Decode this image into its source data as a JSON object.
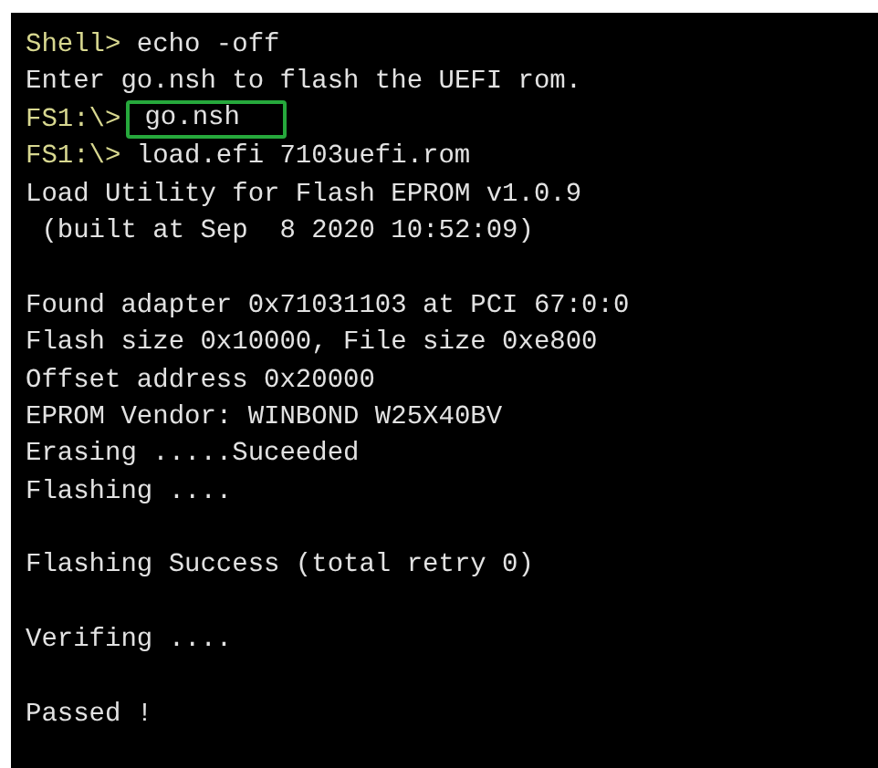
{
  "terminal": {
    "lines": [
      {
        "kind": "command",
        "prompt": "Shell>",
        "text": "echo -off",
        "highlighted": false
      },
      {
        "kind": "output",
        "text": "Enter go.nsh to flash the UEFI rom."
      },
      {
        "kind": "command",
        "prompt": "FS1:\\>",
        "text": "go.nsh",
        "highlighted": true
      },
      {
        "kind": "command",
        "prompt": "FS1:\\>",
        "text": "load.efi 7103uefi.rom",
        "highlighted": false
      },
      {
        "kind": "output",
        "text": "Load Utility for Flash EPROM v1.0.9"
      },
      {
        "kind": "output",
        "text": " (built at Sep  8 2020 10:52:09)"
      },
      {
        "kind": "blank"
      },
      {
        "kind": "output",
        "text": "Found adapter 0x71031103 at PCI 67:0:0"
      },
      {
        "kind": "output",
        "text": "Flash size 0x10000, File size 0xe800"
      },
      {
        "kind": "output",
        "text": "Offset address 0x20000"
      },
      {
        "kind": "output",
        "text": "EPROM Vendor: WINBOND W25X40BV"
      },
      {
        "kind": "output",
        "text": "Erasing .....Suceeded"
      },
      {
        "kind": "output",
        "text": "Flashing ...."
      },
      {
        "kind": "blank"
      },
      {
        "kind": "output",
        "text": "Flashing Success (total retry 0)"
      },
      {
        "kind": "blank"
      },
      {
        "kind": "output",
        "text": "Verifing ...."
      },
      {
        "kind": "blank"
      },
      {
        "kind": "output",
        "text": "Passed !"
      }
    ]
  }
}
